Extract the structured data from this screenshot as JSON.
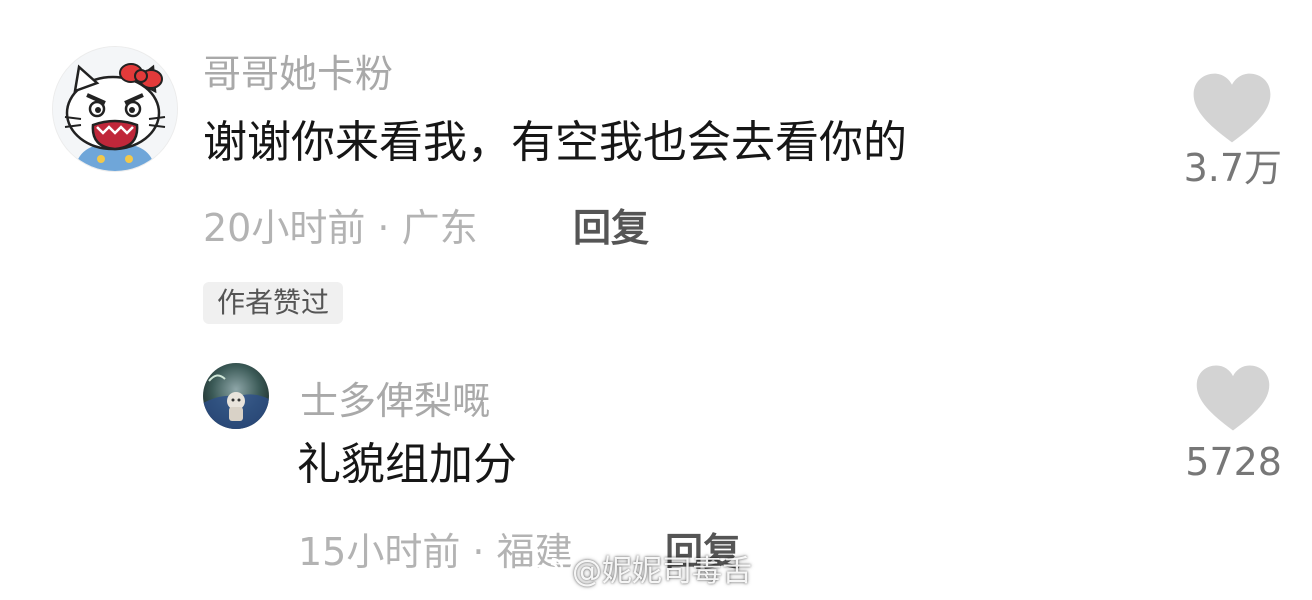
{
  "comments": [
    {
      "username": "哥哥她卡粉",
      "text": "谢谢你来看我，有空我也会去看你的",
      "meta": "20小时前 · 广东",
      "reply_label": "回复",
      "badge": "作者赞过",
      "like_count": "3.7万",
      "avatar_icon": "hello-kitty-avatar"
    },
    {
      "username": "士多俾梨嘅",
      "text": "礼貌组加分",
      "meta": "15小时前 · 福建",
      "reply_label": "回复",
      "like_count": "5728",
      "avatar_icon": "photo-avatar"
    }
  ],
  "watermark": {
    "text": "@妮妮司毒舌",
    "icon": "weibo-logo"
  },
  "colors": {
    "like_heart": "#d3d3d3",
    "username": "#a9a9a9",
    "comment_text": "#161616",
    "meta": "#b3b3b3",
    "reply": "#555555",
    "badge_bg": "#f0f0f0"
  }
}
